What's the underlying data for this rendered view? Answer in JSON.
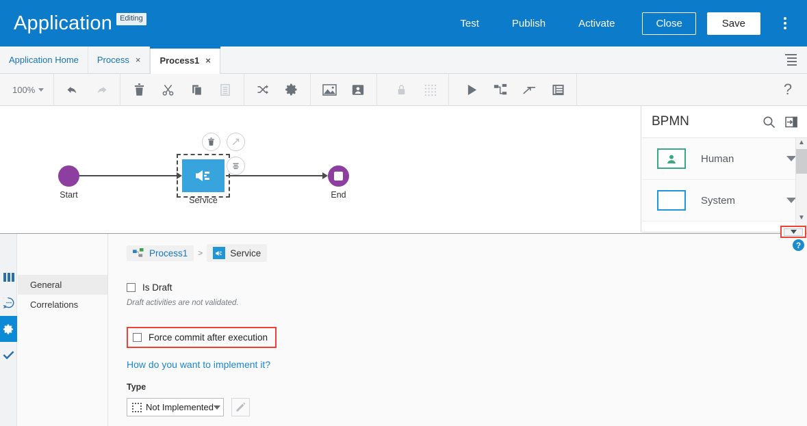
{
  "header": {
    "title": "Application",
    "badge": "Editing",
    "links": [
      {
        "label": "Test",
        "name": "test"
      },
      {
        "label": "Publish",
        "name": "publish"
      },
      {
        "label": "Activate",
        "name": "activate"
      }
    ],
    "close_label": "Close",
    "save_label": "Save",
    "overflow_icon": "kebab-menu-icon"
  },
  "tabs": {
    "items": [
      {
        "label": "Application Home",
        "closable": false,
        "active": false
      },
      {
        "label": "Process",
        "closable": true,
        "active": false
      },
      {
        "label": "Process1",
        "closable": true,
        "active": true
      }
    ],
    "close_glyph": "×",
    "menu_icon": "tab-list-icon"
  },
  "toolbar": {
    "zoom_value": "100%",
    "icons": [
      "undo-icon",
      "redo-icon",
      "delete-icon",
      "cut-icon",
      "copy-icon",
      "paste-icon",
      "shuffle-icon",
      "settings-gear-icon",
      "image-icon",
      "user-card-icon",
      "lock-icon",
      "grid-icon",
      "play-icon",
      "flow-icon",
      "merge-icon",
      "report-icon",
      "help-icon"
    ],
    "help_glyph": "?"
  },
  "canvas": {
    "nodes": [
      {
        "id": "start",
        "label": "Start",
        "type": "start-event"
      },
      {
        "id": "service",
        "label": "Service",
        "type": "service-task",
        "selected": true
      },
      {
        "id": "end",
        "label": "End",
        "type": "end-event"
      }
    ],
    "floating_actions": [
      {
        "name": "delete-node-button",
        "icon": "trash-icon"
      },
      {
        "name": "connect-node-button",
        "icon": "arrow-diagonal-icon"
      },
      {
        "name": "node-menu-button",
        "icon": "list-lines-icon"
      }
    ],
    "colors": {
      "event": "#8d3f9f",
      "service": "#38a4de",
      "flow": "#4a4a4a"
    }
  },
  "palette": {
    "title": "BPMN",
    "search_icon": "search-icon",
    "collapse_icon": "panel-collapse-icon",
    "items": [
      {
        "label": "Human",
        "swatch_color": "#3aa882",
        "icon": "person-icon"
      },
      {
        "label": "System",
        "swatch_color": "#2196d6",
        "icon": "empty-box-icon"
      }
    ],
    "scroll_up": "▲",
    "scroll_down": "▼",
    "collapse_bar_glyph": "▼",
    "help_glyph": "?"
  },
  "properties": {
    "rail_icons": [
      {
        "name": "data-columns-icon",
        "active": false
      },
      {
        "name": "comment-icon",
        "active": false
      },
      {
        "name": "gear-icon",
        "active": true
      },
      {
        "name": "check-icon",
        "active": false
      }
    ],
    "nav_items": [
      {
        "label": "General",
        "active": true
      },
      {
        "label": "Correlations",
        "active": false
      }
    ],
    "breadcrumb": {
      "root": "Process1",
      "separator": ">",
      "current": "Service",
      "root_icon": "process-diagram-icon",
      "current_icon": "service-plug-icon"
    },
    "is_draft": {
      "label": "Is Draft",
      "checked": false
    },
    "draft_hint": "Draft activities are not validated.",
    "force_commit": {
      "label": "Force commit after execution",
      "checked": false,
      "highlighted": true
    },
    "implement_link": "How do you want to implement it?",
    "type_label": "Type",
    "type_value": "Not Implemented",
    "edit_icon": "pencil-icon",
    "highlight_color": "#ef4136"
  }
}
